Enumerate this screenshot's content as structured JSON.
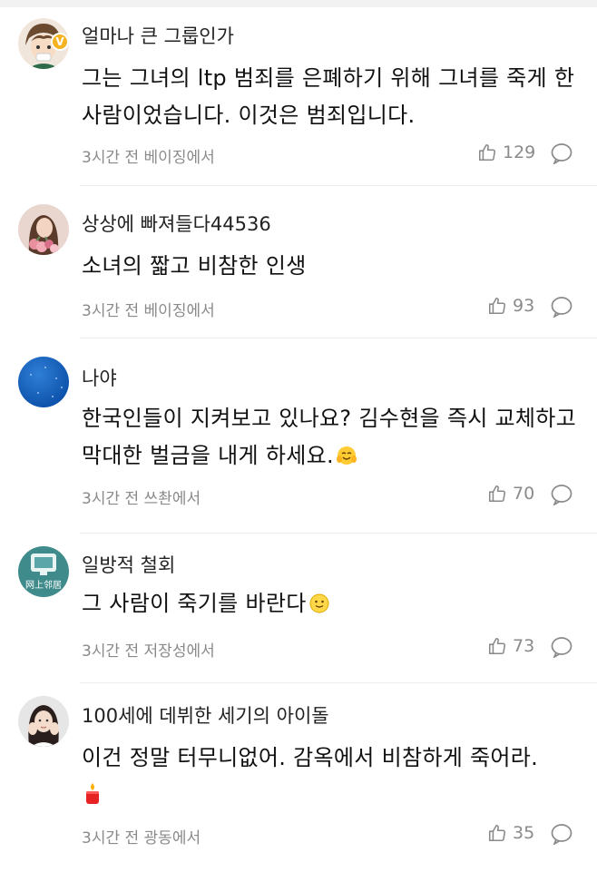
{
  "comments": [
    {
      "username": "얼마나 큰 그룹인가",
      "text": "그는 그녀의 ltp 범죄를 은폐하기 위해 그녀를 죽게 한 사람이었습니다. 이것은 범죄입니다.",
      "meta": "3시간 전 베이징에서",
      "likes": "129",
      "verified_badge": "V",
      "avatar_icon": "cartoon-face-avatar"
    },
    {
      "username": "상상에 빠져들다44536",
      "text": "소녀의 짧고 비참한 인생",
      "meta": "3시간 전 베이징에서",
      "likes": "93",
      "avatar_icon": "girl-with-flowers-avatar"
    },
    {
      "username": "나야",
      "text": "한국인들이 지켜보고 있나요? 김수현을 즉시 교체하고 막대한 벌금을 내게 하세요.",
      "meta": "3시간 전 쓰촨에서",
      "likes": "70",
      "avatar_icon": "blue-sphere-avatar",
      "emoji": "smiling-face-with-hands-emoji"
    },
    {
      "username": "일방적 철회",
      "text": "그 사람이 죽기를 바란다",
      "meta": "3시간 전 저장성에서",
      "likes": "73",
      "avatar_icon": "net-neighbor-avatar",
      "avatar_text": "网上邻居",
      "emoji": "slight-smile-emoji"
    },
    {
      "username": "100세에 데뷔한 세기의 아이돌",
      "text": "이건 정말 터무니없어. 감옥에서 비참하게 죽어라.",
      "meta": "3시간 전 광동에서",
      "likes": "35",
      "avatar_icon": "woman-portrait-avatar",
      "emoji": "candle-emoji"
    }
  ],
  "colors": {
    "meta_text": "#8a8a8a",
    "badge": "#f5b323",
    "divider": "#ececec"
  }
}
